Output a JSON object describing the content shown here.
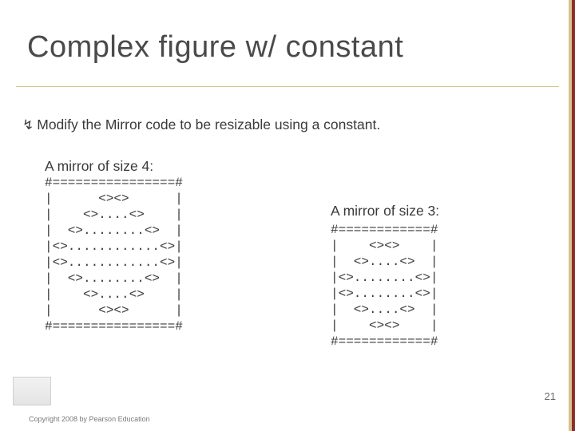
{
  "title": "Complex figure w/ constant",
  "bullet_glyph": "༄",
  "intro": "Modify the Mirror code to be resizable using a constant.",
  "left": {
    "label": "A mirror of size 4:",
    "lines": [
      "#================#",
      "|      <><>      |",
      "|    <>....<>    |",
      "|  <>........<>  |",
      "|<>............<>|",
      "|<>............<>|",
      "|  <>........<>  |",
      "|    <>....<>    |",
      "|      <><>      |",
      "#================#"
    ]
  },
  "right": {
    "label": "A mirror of size 3:",
    "lines": [
      "#============#",
      "|    <><>    |",
      "|  <>....<>  |",
      "|<>........<>|",
      "|<>........<>|",
      "|  <>....<>  |",
      "|    <><>    |",
      "#============#"
    ]
  },
  "copyright": "Copyright 2008 by Pearson Education",
  "page_number": "21"
}
